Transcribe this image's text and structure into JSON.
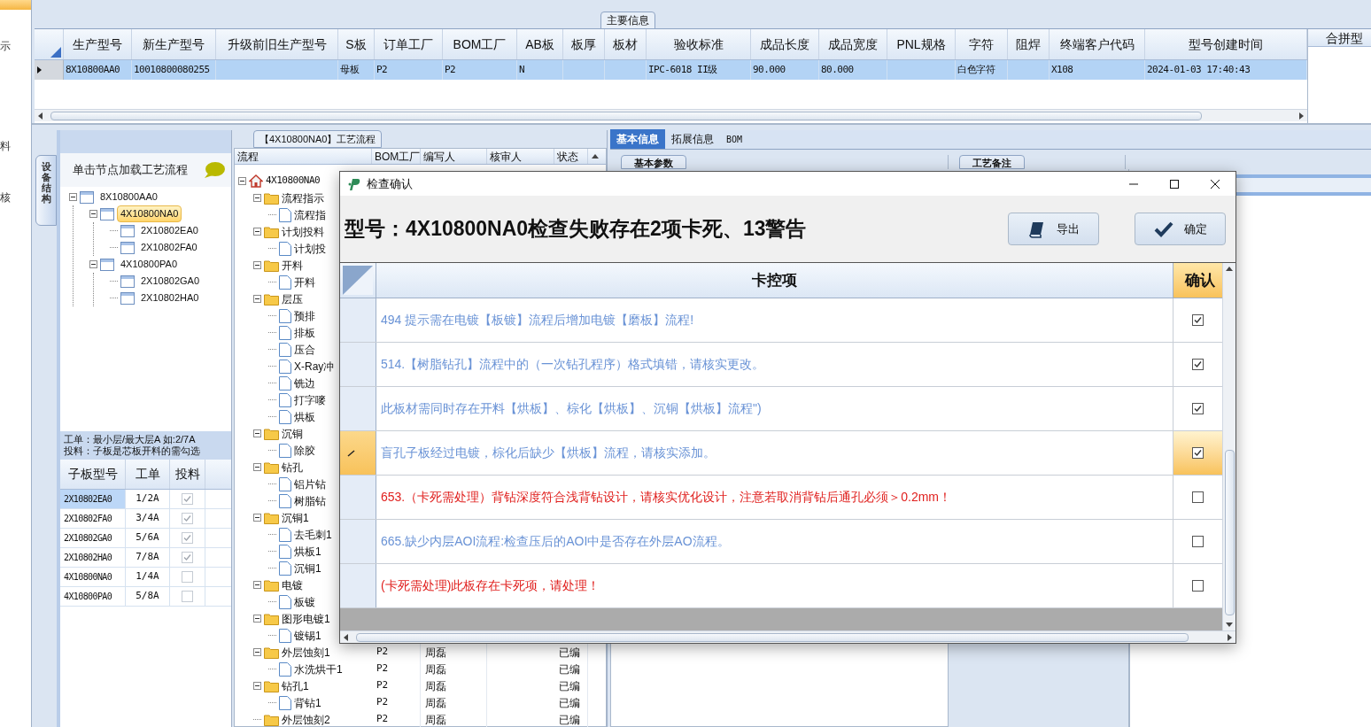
{
  "side_menu": [
    {
      "label": "示"
    },
    {
      "label": "料"
    },
    {
      "label": "核"
    }
  ],
  "main_info": {
    "title": "主要信息",
    "columns": [
      "生产型号",
      "新生产型号",
      "升级前旧生产型号",
      "S板",
      "订单工厂",
      "BOM工厂",
      "AB板",
      "板厚",
      "板材",
      "验收标准",
      "成品长度",
      "成品宽度",
      "PNL规格",
      "字符",
      "阻焊",
      "终端客户代码",
      "型号创建时间"
    ],
    "rows": [
      {
        "selected": true,
        "cells": [
          "8X10800AA0",
          "10010800080255",
          null,
          "母板",
          "P2",
          "P2",
          "N",
          null,
          null,
          "IPC-6018 II级",
          "90.000",
          "80.000",
          null,
          "白色字符",
          null,
          "X108",
          "2024-01-03 17:40:43"
        ]
      }
    ],
    "side_column": "合拼型"
  },
  "structure_panel": {
    "tab": "设备结构",
    "hint": "单击节点加载工艺流程",
    "tree": [
      {
        "label": "8X10800AA0",
        "selected": false,
        "children": [
          {
            "label": "4X10800NA0",
            "selected": true,
            "children": [
              {
                "label": "2X10802EA0",
                "selected": false
              },
              {
                "label": "2X10802FA0",
                "selected": false
              }
            ]
          },
          {
            "label": "4X10800PA0",
            "selected": false,
            "children": [
              {
                "label": "2X10802GA0",
                "selected": false
              },
              {
                "label": "2X10802HA0",
                "selected": false
              }
            ]
          }
        ]
      }
    ],
    "note": [
      "工单：最小层/最大层A 如:2/7A",
      "投料：子板是芯板开料的需勾选"
    ],
    "table": {
      "columns": [
        "子板型号",
        "工单",
        "投料"
      ],
      "rows": [
        {
          "board": "2X10802EA0",
          "order": "1/2A",
          "feed": true,
          "selected": true
        },
        {
          "board": "2X10802FA0",
          "order": "3/4A",
          "feed": true,
          "selected": false
        },
        {
          "board": "2X10802GA0",
          "order": "5/6A",
          "feed": true,
          "selected": false
        },
        {
          "board": "2X10802HA0",
          "order": "7/8A",
          "feed": true,
          "selected": false
        },
        {
          "board": "4X10800NA0",
          "order": "1/4A",
          "feed": false,
          "selected": false
        },
        {
          "board": "4X10800PA0",
          "order": "5/8A",
          "feed": false,
          "selected": false
        }
      ]
    }
  },
  "flow_panel": {
    "title": "【4X10800NA0】工艺流程",
    "columns": [
      "流程",
      "BOM工厂",
      "编写人",
      "核审人",
      "状态"
    ],
    "tree": [
      {
        "kind": "root",
        "label": "4X10800NA0",
        "children": [
          {
            "kind": "folder",
            "label": "流程指示",
            "children": [
              {
                "kind": "file",
                "label": "流程指"
              }
            ]
          },
          {
            "kind": "folder",
            "label": "计划投料",
            "children": [
              {
                "kind": "file",
                "label": "计划投"
              }
            ]
          },
          {
            "kind": "folder",
            "label": "开料",
            "children": [
              {
                "kind": "file",
                "label": "开料"
              }
            ]
          },
          {
            "kind": "folder",
            "label": "层压",
            "children": [
              {
                "kind": "file",
                "label": "预排"
              },
              {
                "kind": "file",
                "label": "排板"
              },
              {
                "kind": "file",
                "label": "压合"
              },
              {
                "kind": "file",
                "label": "X-Ray冲"
              },
              {
                "kind": "file",
                "label": "铣边"
              },
              {
                "kind": "file",
                "label": "打字嘜"
              },
              {
                "kind": "file",
                "label": "烘板"
              }
            ]
          },
          {
            "kind": "folder",
            "label": "沉铜",
            "children": [
              {
                "kind": "file",
                "label": "除胶"
              }
            ]
          },
          {
            "kind": "folder",
            "label": "钻孔",
            "children": [
              {
                "kind": "file",
                "label": "铝片钻"
              },
              {
                "kind": "file",
                "label": "树脂钻"
              }
            ]
          },
          {
            "kind": "folder",
            "label": "沉铜1",
            "children": [
              {
                "kind": "file",
                "label": "去毛刺1"
              },
              {
                "kind": "file",
                "label": "烘板1"
              },
              {
                "kind": "file",
                "label": "沉铜1"
              }
            ]
          },
          {
            "kind": "folder",
            "label": "电镀",
            "children": [
              {
                "kind": "file",
                "label": "板镀"
              }
            ]
          },
          {
            "kind": "folder",
            "label": "图形电镀1",
            "children": [
              {
                "kind": "file",
                "label": "镀锡1"
              }
            ]
          },
          {
            "kind": "folder",
            "label": "外层蚀刻1",
            "cells": [
              "P2",
              "周磊",
              "已编"
            ],
            "children": [
              {
                "kind": "file",
                "label": "水洗烘干1",
                "cells": [
                  "P2",
                  "周磊",
                  "已编"
                ]
              }
            ]
          },
          {
            "kind": "folder",
            "label": "钻孔1",
            "cells": [
              "P2",
              "周磊",
              "已编"
            ],
            "children": [
              {
                "kind": "file",
                "label": "背钻1",
                "cells": [
                  "P2",
                  "周磊",
                  "已编"
                ]
              }
            ]
          },
          {
            "kind": "folder",
            "label": "外层蚀刻2",
            "cells": [
              "P2",
              "周磊",
              "已编"
            ]
          }
        ]
      }
    ]
  },
  "detail_panel": {
    "tabs": [
      {
        "label": "基本信息",
        "selected": true
      },
      {
        "label": "拓展信息",
        "selected": false
      },
      {
        "label": "BOM",
        "selected": false
      }
    ],
    "groups": [
      "基本参数",
      "工艺备注"
    ]
  },
  "dialog": {
    "title": "检查确认",
    "heading": "型号：4X10800NA0检查失败存在2项卡死、13警告",
    "buttons": [
      {
        "label": "导出",
        "kind": "export"
      },
      {
        "label": "确定",
        "kind": "confirm"
      }
    ],
    "columns": [
      "卡控项",
      "确认"
    ],
    "rows": [
      {
        "text": "494 提示需在电镀【板镀】流程后增加电镀【磨板】流程!",
        "kind": "warning",
        "checked": true,
        "selected": false
      },
      {
        "text": "514.【树脂钻孔】流程中的（一次钻孔程序）格式填错，请核实更改。",
        "kind": "warning",
        "checked": true,
        "selected": false
      },
      {
        "text": "此板材需同时存在开料【烘板】、棕化【烘板】、沉铜【烘板】流程\")",
        "kind": "warning",
        "checked": true,
        "selected": false
      },
      {
        "text": "盲孔子板经过电镀，棕化后缺少【烘板】流程，请核实添加。",
        "kind": "warning",
        "checked": true,
        "selected": true
      },
      {
        "text": "653.（卡死需处理）背钻深度符合浅背钻设计，请核实优化设计，注意若取消背钻后通孔必须＞0.2mm！",
        "kind": "fatal",
        "checked": false,
        "selected": false
      },
      {
        "text": "665.缺少内层AOI流程:检查压后的AOI中是否存在外层AO流程。",
        "kind": "warning",
        "checked": false,
        "selected": false
      },
      {
        "text": "(卡死需处理)此板存在卡死项，请处理！",
        "kind": "fatal",
        "checked": false,
        "selected": false
      }
    ]
  }
}
